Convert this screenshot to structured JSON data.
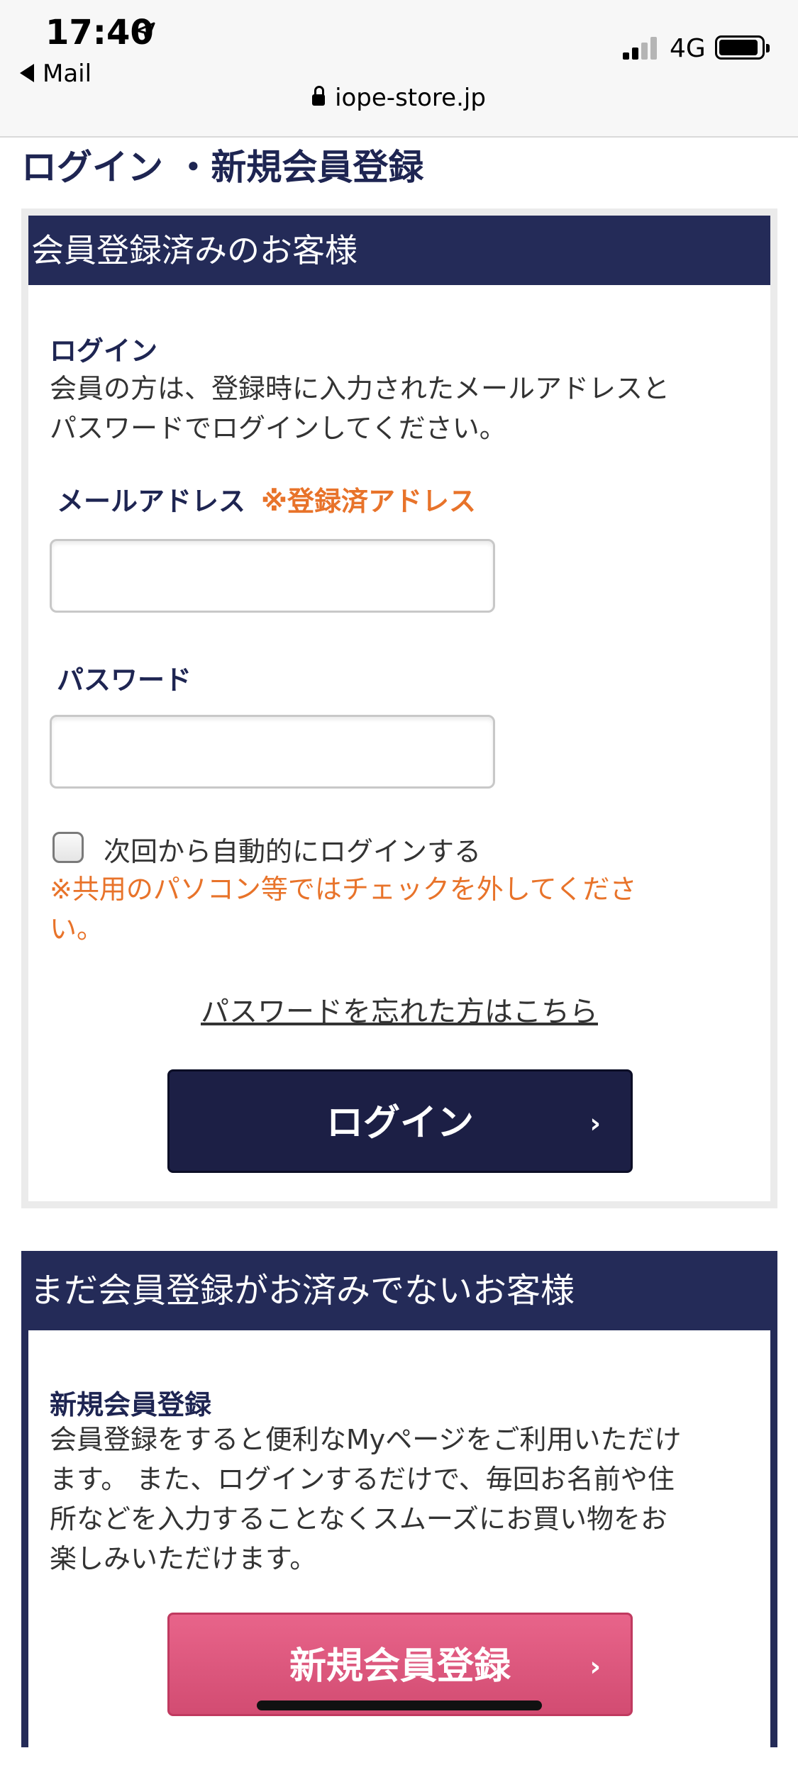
{
  "status_bar": {
    "time": "17:40",
    "back_label": "Mail",
    "network": "4G",
    "url": "iope-store.jp"
  },
  "page": {
    "title": "ログイン ・新規会員登録"
  },
  "login_panel": {
    "header": "会員登録済みのお客様",
    "section_title": "ログイン",
    "description_line1": "会員の方は、登録時に入力されたメールアドレスと",
    "description_line2": "パスワードでログインしてください。",
    "email_label": "メールアドレス",
    "email_note": "※登録済アドレス",
    "email_value": "",
    "password_label": "パスワード",
    "password_value": "",
    "auto_login_label": "次回から自動的にログインする",
    "warning_line1": "※共用のパソコン等ではチェックを外してくださ",
    "warning_line2": "い。",
    "forgot_password": "パスワードを忘れた方はこちら",
    "login_button": "ログイン",
    "chevron": "›"
  },
  "register_panel": {
    "header": "まだ会員登録がお済みでないお客様",
    "section_title": "新規会員登録",
    "description_line1": "会員登録をすると便利なMyページをご利用いただけ",
    "description_line2": "ます。 また、ログインするだけで、毎回お名前や住",
    "description_line3": "所などを入力することなくスムーズにお買い物をお",
    "description_line4": "楽しみいただけます。",
    "register_button": "新規会員登録",
    "chevron": "›"
  },
  "colors": {
    "navy": "#242b58",
    "accent_orange": "#e8732a",
    "register_pink": "#dc5a7e"
  }
}
